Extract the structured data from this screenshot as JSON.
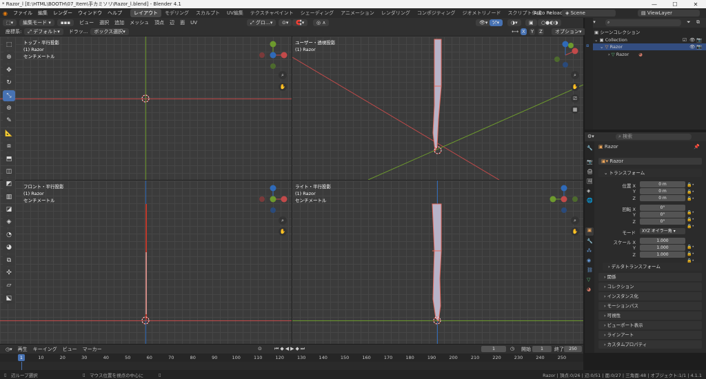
{
  "window": {
    "title": "* Razor_l [E:\\HTML\\BOOTH\\07_Item\\手カミソリ\\Razor_l.blend] - Blender 4.1"
  },
  "topmenu": {
    "items": [
      "ファイル",
      "編集",
      "レンダー",
      "ウィンドウ",
      "ヘルプ"
    ],
    "workspaces": [
      "レイアウト",
      "モデリング",
      "スカルプト",
      "UV編集",
      "テクスチャペイント",
      "シェーディング",
      "アニメーション",
      "レンダリング",
      "コンポジティング",
      "ジオメトリノード",
      "スクリプト作成"
    ],
    "auto_reload": "Auto Reload",
    "scene": "Scene",
    "view_layer": "ViewLayer"
  },
  "viewheader": {
    "mode": "編集モード",
    "menus": [
      "ビュー",
      "選択",
      "追加",
      "メッシュ",
      "頂点",
      "辺",
      "面",
      "UV"
    ],
    "transform": "グロ…",
    "options": "オプション"
  },
  "toolheader": {
    "orient_label": "座標系:",
    "orient": "デフォルト",
    "drag": "ドラッ...",
    "select": "ボックス選択",
    "axes": [
      "X",
      "Y",
      "Z"
    ]
  },
  "viewports": [
    {
      "title": "トップ・平行投影",
      "obj": "(1) Razor",
      "unit": "センチメートル"
    },
    {
      "title": "ユーザー・透視投影",
      "obj": "(1) Razor",
      "unit": ""
    },
    {
      "title": "フロント・平行投影",
      "obj": "(1) Razor",
      "unit": "センチメートル"
    },
    {
      "title": "ライト・平行投影",
      "obj": "(1) Razor",
      "unit": "センチメートル"
    }
  ],
  "outliner": {
    "search": "",
    "scene_collection": "シーンコレクション",
    "collection": "Collection",
    "object": "Razor",
    "mesh": "Razor"
  },
  "properties": {
    "search": "検索",
    "object_name": "Razor",
    "data_name": "Razor",
    "transform": "トランスフォーム",
    "location_label": "位置 X",
    "rotation_label": "回転 X",
    "mode_label": "モード",
    "scale_label": "スケール X",
    "y": "Y",
    "z": "Z",
    "location": [
      "0 m",
      "0 m",
      "0 m"
    ],
    "rotation": [
      "0°",
      "0°",
      "0°"
    ],
    "mode": "XYZ オイラー角",
    "scale": [
      "1.000",
      "1.000",
      "1.000"
    ],
    "sections": [
      "デルタトランスフォーム",
      "関係",
      "コレクション",
      "インスタンス化",
      "モーションパス",
      "可視性",
      "ビューポート表示",
      "ラインアート",
      "カスタムプロパティ"
    ]
  },
  "timeline": {
    "menus": [
      "再生",
      "キーイング",
      "ビュー",
      "マーカー"
    ],
    "current": "1",
    "start_label": "開始",
    "start": "1",
    "end_label": "終了",
    "end": "250",
    "ticks": [
      "1",
      "10",
      "20",
      "30",
      "40",
      "50",
      "60",
      "70",
      "80",
      "90",
      "100",
      "110",
      "120",
      "130",
      "140",
      "150",
      "160",
      "170",
      "180",
      "190",
      "200",
      "210",
      "220",
      "230",
      "240",
      "250"
    ]
  },
  "status": {
    "left": "辺ループ選択",
    "middle": "マウス位置を視点の中心に",
    "right": "Razor | 頂点:0/26 | 辺:0/51 | 面:0/27 | 三角面:48 | オブジェクト:1/1 | 4.1.1"
  },
  "colors": {
    "accent": "#4772b3",
    "x_axis": "#c24a4a",
    "y_axis": "#6d9a2d",
    "z_axis": "#2f6ab8",
    "selection": "#e36a5e"
  }
}
